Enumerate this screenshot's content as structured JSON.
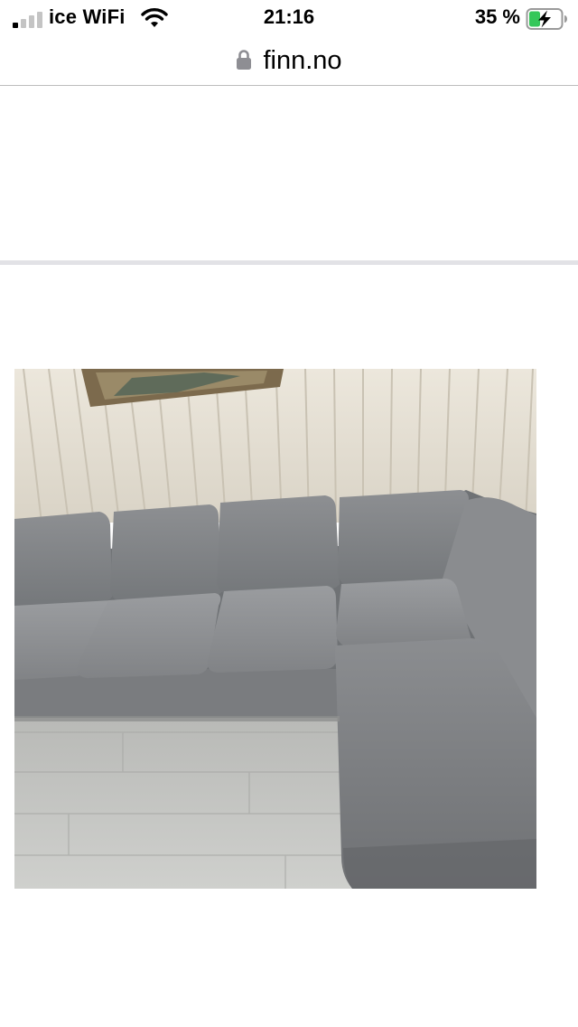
{
  "status_bar": {
    "carrier": "ice WiFi",
    "time": "21:16",
    "battery_percent": "35 %",
    "signal_bars_active": 1,
    "signal_bars_total": 4,
    "battery_level": 0.35,
    "charging": true,
    "battery_color": "#34c759",
    "icons": [
      "cellular-signal-icon",
      "wifi-icon",
      "battery-charging-icon"
    ]
  },
  "address_bar": {
    "domain": "finn.no",
    "icon": "lock-icon"
  },
  "content": {
    "photo_description_icon": "photo",
    "divider_color": "#e2e2e6"
  }
}
